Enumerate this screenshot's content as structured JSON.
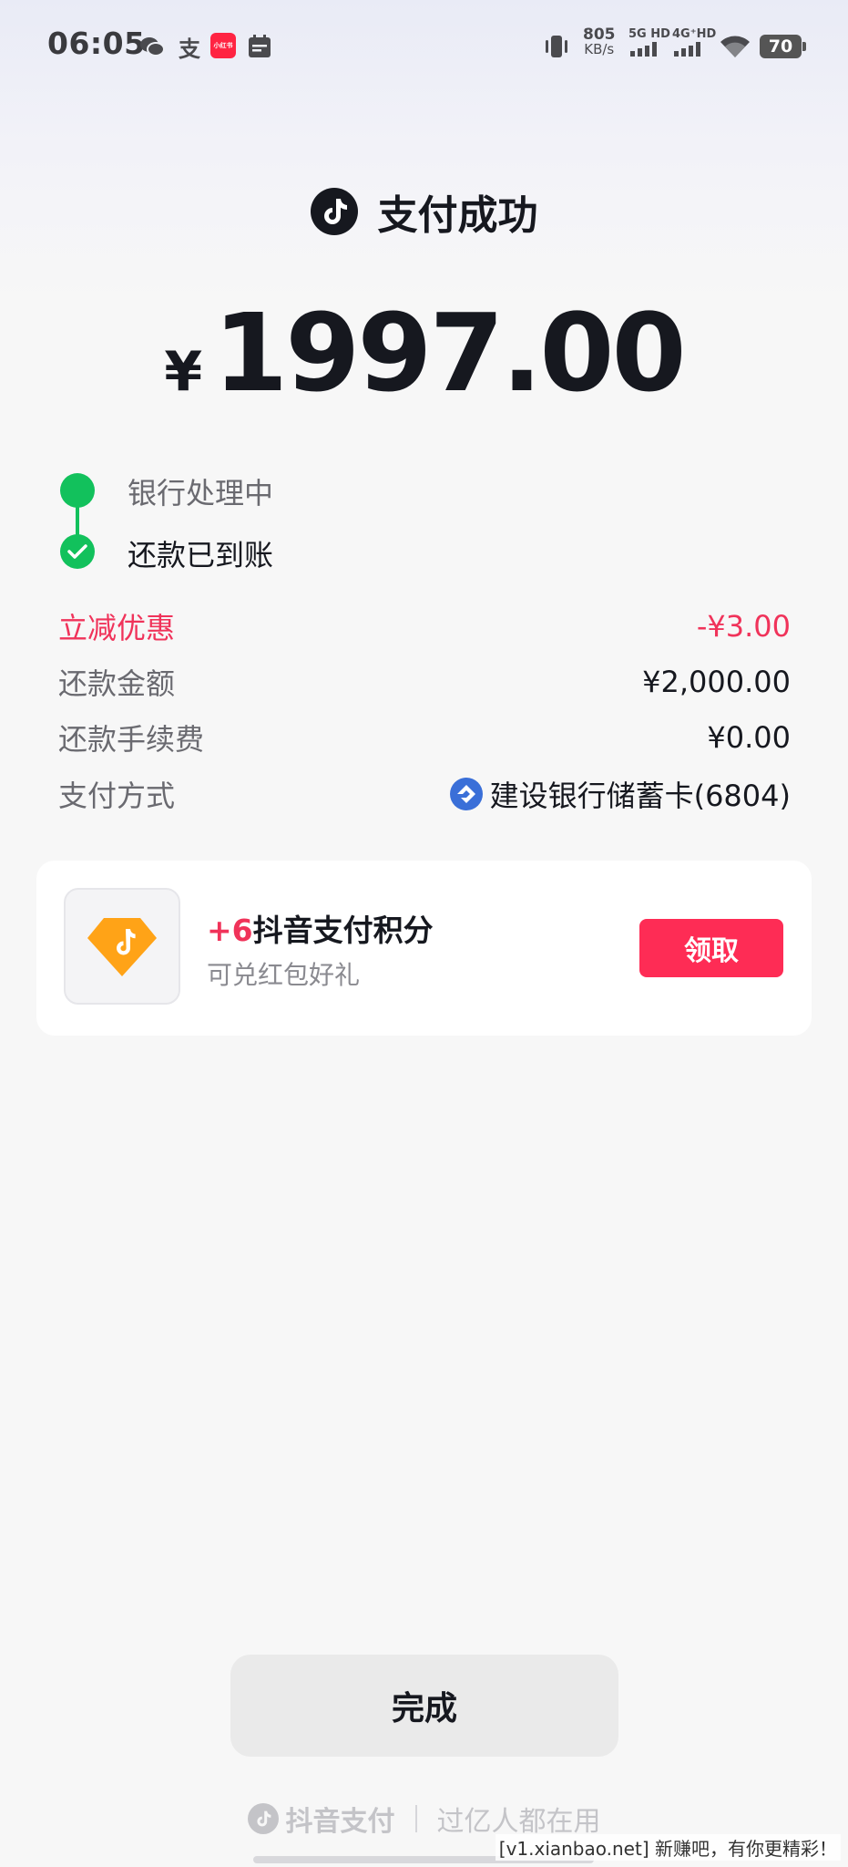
{
  "status_bar": {
    "time": "06:05",
    "speed_value": "805",
    "speed_unit": "KB/s",
    "sim1": "5G HD",
    "sim2": "4G⁺HD",
    "battery": "70",
    "notify_icons": [
      "wechat-icon",
      "alipay-icon",
      "xiaohongshu-icon",
      "calendar-icon"
    ],
    "xiaohongshu_label": "小红书"
  },
  "header": {
    "title": "支付成功",
    "currency_symbol": "¥",
    "amount": "1997.00"
  },
  "progress": {
    "steps": [
      {
        "label": "银行处理中"
      },
      {
        "label": "还款已到账"
      }
    ]
  },
  "details": [
    {
      "label": "立减优惠",
      "value": "-¥3.00"
    },
    {
      "label": "还款金额",
      "value": "¥2,000.00"
    },
    {
      "label": "还款手续费",
      "value": "¥0.00"
    },
    {
      "label": "支付方式",
      "value": "建设银行储蓄卡(6804)"
    }
  ],
  "reward_card": {
    "points_prefix": "+6",
    "title": "抖音支付积分",
    "subtitle": "可兑红包好礼",
    "button": "领取"
  },
  "done_button": "完成",
  "footer": {
    "brand": "抖音支付",
    "slogan": "过亿人都在用"
  },
  "watermark": "[v1.xianbao.net] 新赚吧，有你更精彩！",
  "colors": {
    "accent": "#fe2c55",
    "discount": "#f0335a",
    "success": "#12c15c"
  }
}
